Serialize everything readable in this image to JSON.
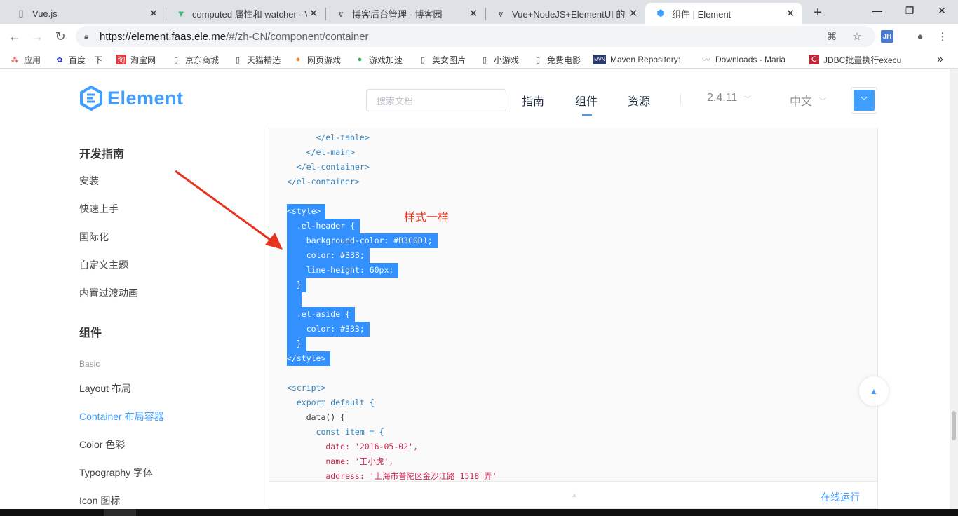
{
  "browser": {
    "tabs": [
      {
        "title": "Vue.js",
        "icon": "page-icon"
      },
      {
        "title": "computed 属性和 watcher - V",
        "icon": "vue-logo-icon"
      },
      {
        "title": "博客后台管理 - 博客园",
        "icon": "cnblogs-icon"
      },
      {
        "title": "Vue+NodeJS+ElementUI 的",
        "icon": "cnblogs-icon"
      },
      {
        "title": "组件 | Element",
        "icon": "element-logo-icon"
      }
    ],
    "url_host": "https://element.faas.ele.me",
    "url_path": "/#/zh-CN/component/container",
    "extension_label": "JH",
    "bookmarks": [
      "应用",
      "百度一下",
      "淘宝网",
      "京东商城",
      "天猫精选",
      "网页游戏",
      "游戏加速",
      "美女图片",
      "小游戏",
      "免费电影",
      "Maven Repository:",
      "Downloads - Maria",
      "JDBC批量执行execu"
    ],
    "more_bookmarks": "»"
  },
  "header": {
    "logo_text": "Element",
    "search_placeholder": "搜索文档",
    "nav": [
      "指南",
      "组件",
      "资源"
    ],
    "version": "2.4.11",
    "language": "中文"
  },
  "sidebar": {
    "guide_title": "开发指南",
    "guide_items": [
      "安装",
      "快速上手",
      "国际化",
      "自定义主题",
      "内置过渡动画"
    ],
    "component_title": "组件",
    "group_basic": "Basic",
    "component_items": [
      "Layout 布局",
      "Container 布局容器",
      "Color 色彩",
      "Typography 字体",
      "Icon 图标"
    ]
  },
  "code": {
    "lines": [
      "      </el-table>",
      "    </el-main>",
      "  </el-container>",
      "</el-container>",
      "",
      "<style>",
      "  .el-header {",
      "    background-color: #B3C0D1;",
      "    color: #333;",
      "    line-height: 60px;",
      "  }",
      "",
      "  .el-aside {",
      "    color: #333;",
      "  }",
      "</style>",
      "",
      "<script>",
      "  export default {",
      "    data() {",
      "      const item = {",
      "        date: '2016-05-02',",
      "        name: '王小虎',",
      "        address: '上海市普陀区金沙江路 1518 弄'"
    ],
    "run_online": "在线运行"
  },
  "annotation": "样式一样"
}
